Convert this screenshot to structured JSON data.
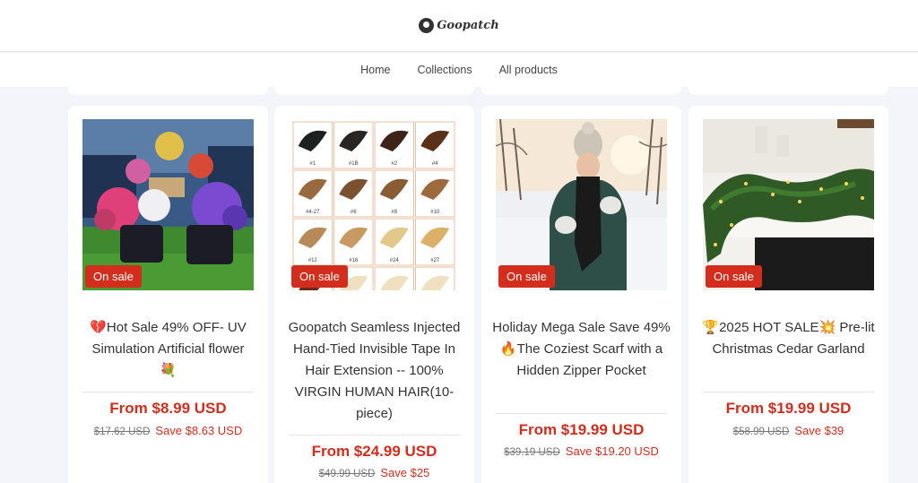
{
  "header": {
    "logo_text": "Goopatch"
  },
  "nav": {
    "items": [
      "Home",
      "Collections",
      "All products"
    ]
  },
  "products": [
    {
      "badge": "On sale",
      "title_icon": "💔",
      "title": "Hot Sale 49% OFF- UV Simulation Artificial flower",
      "title_icon_after": "💐",
      "price": "From $8.99 USD",
      "old_price": "$17.62 USD",
      "save": "Save $8.63 USD",
      "image": "flower-planters-image"
    },
    {
      "badge": "On sale",
      "title": "Goopatch Seamless Injected Hand-Tied Invisible Tape In Hair Extension -- 100% VIRGIN HUMAN HAIR(10-piece)",
      "price": "From $24.99 USD",
      "old_price": "$49.99 USD",
      "save": "Save $25",
      "image": "hair-color-swatches-image",
      "swatch_labels": [
        "#1",
        "#1B",
        "#2",
        "#4",
        "#4-27",
        "#6",
        "#8",
        "#10",
        "#12",
        "#16",
        "#24",
        "#27"
      ]
    },
    {
      "badge": "On sale",
      "title": "Holiday Mega Sale Save 49%",
      "title_icon": "🔥",
      "title_rest": "The Coziest Scarf with a Hidden Zipper Pocket",
      "price": "From $19.99 USD",
      "old_price": "$39.19 USD",
      "save": "Save $19.20 USD",
      "image": "woman-scarf-snow-image"
    },
    {
      "badge": "On sale",
      "title_icon": "🏆",
      "title": "2025 HOT SALE",
      "title_icon_after": "💥",
      "title_rest": " Pre-lit Christmas Cedar Garland",
      "price": "From $19.99 USD",
      "old_price": "$58.99 USD",
      "save": "Save $39",
      "image": "christmas-garland-image"
    }
  ],
  "colors": {
    "sale": "#d32d1d",
    "background": "#f3f5fb"
  }
}
